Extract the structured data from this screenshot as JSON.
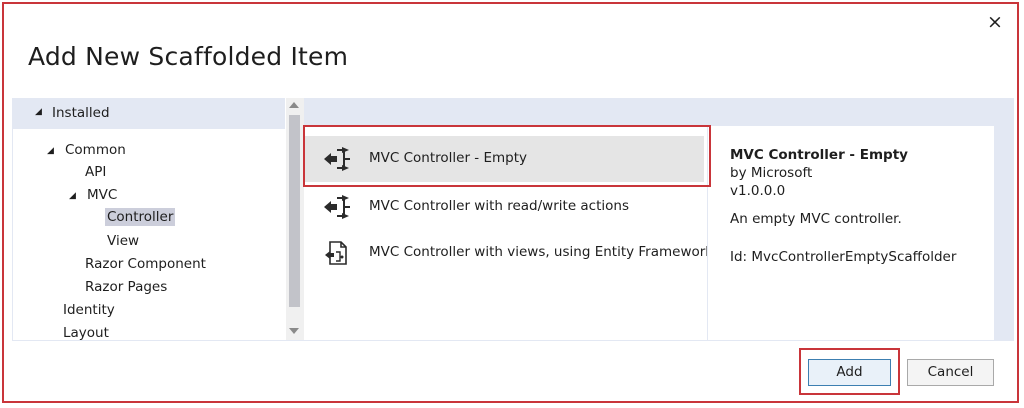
{
  "dialog": {
    "title": "Add New Scaffolded Item",
    "close_glyph": "×"
  },
  "tree": {
    "header": "Installed",
    "items": [
      {
        "label": "Common",
        "level": 0,
        "expanded": true
      },
      {
        "label": "API",
        "level": 1
      },
      {
        "label": "MVC",
        "level": 1,
        "expanded": true
      },
      {
        "label": "Controller",
        "level": 2,
        "selected": true
      },
      {
        "label": "View",
        "level": 2
      },
      {
        "label": "Razor Component",
        "level": 1
      },
      {
        "label": "Razor Pages",
        "level": 1
      },
      {
        "label": "Identity",
        "level": 0
      },
      {
        "label": "Layout",
        "level": 0
      }
    ]
  },
  "templates": [
    {
      "label": "MVC Controller - Empty",
      "icon": "controller-icon",
      "selected": true
    },
    {
      "label": "MVC Controller with read/write actions",
      "icon": "controller-icon"
    },
    {
      "label": "MVC Controller with views, using Entity Framework",
      "icon": "controller-views-icon"
    }
  ],
  "details": {
    "title": "MVC Controller - Empty",
    "author": "by Microsoft",
    "version": "v1.0.0.0",
    "description": "An empty MVC controller.",
    "id": "Id: MvcControllerEmptyScaffolder"
  },
  "buttons": {
    "add": "Add",
    "cancel": "Cancel"
  },
  "colors": {
    "highlight": "#c9353a",
    "panel_header": "#e3e8f3",
    "selection": "#cccedb"
  }
}
